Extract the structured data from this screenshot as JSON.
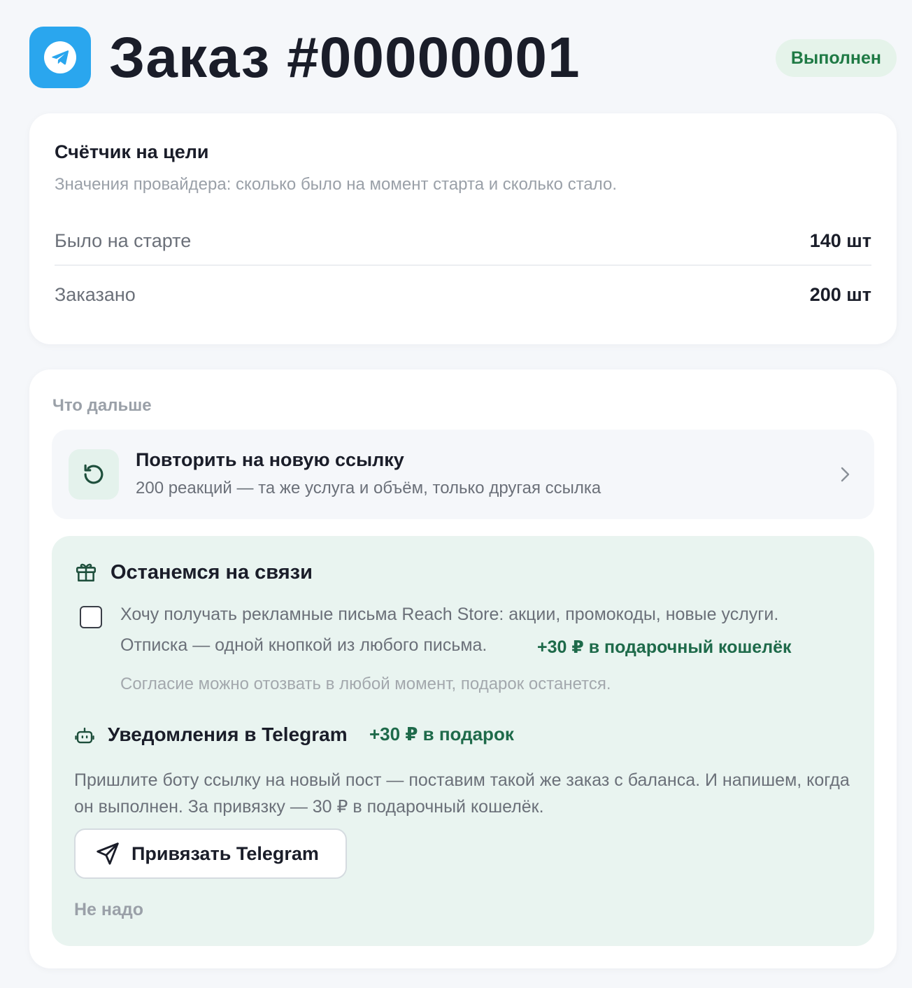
{
  "header": {
    "title": "Заказ #00000001",
    "status": "Выполнен",
    "logo_icon": "telegram-icon"
  },
  "counter": {
    "title": "Счётчик на цели",
    "subtitle": "Значения провайдера: сколько было на момент старта и сколько стало.",
    "rows": [
      {
        "label": "Было на старте",
        "value": "140 шт"
      },
      {
        "label": "Заказано",
        "value": "200 шт"
      }
    ]
  },
  "next": {
    "heading": "Что дальше",
    "repeat": {
      "title": "Повторить на новую ссылку",
      "description": "200 реакций — та же услуга и объём, только другая ссылка",
      "icon": "refresh-icon"
    },
    "stay": {
      "title": "Останемся на связи",
      "icon": "gift-icon",
      "consent": {
        "checked": false,
        "line1": "Хочу получать рекламные письма Reach Store: акции, промокоды, новые услуги.",
        "line2": "Отписка — одной кнопкой из любого письма.",
        "bonus": "+30 ₽ в подарочный кошелёк",
        "note": "Согласие можно отозвать в любой момент, подарок останется."
      },
      "telegram": {
        "title": "Уведомления в Telegram",
        "bonus": "+30 ₽ в подарок",
        "icon": "bot-icon",
        "description": "Пришлите боту ссылку на новый пост — поставим такой же заказ с баланса. И напишем, когда он выполнен. За привязку — 30 ₽ в подарочный кошелёк.",
        "button_label": "Привязать Telegram",
        "button_icon": "send-icon"
      },
      "dismiss_label": "Не надо"
    }
  },
  "colors": {
    "accent_green": "#1e6a4a",
    "status_green": "#1f7a45",
    "telegram_blue": "#2aa6ee",
    "panel_mint": "#e9f4f0"
  }
}
